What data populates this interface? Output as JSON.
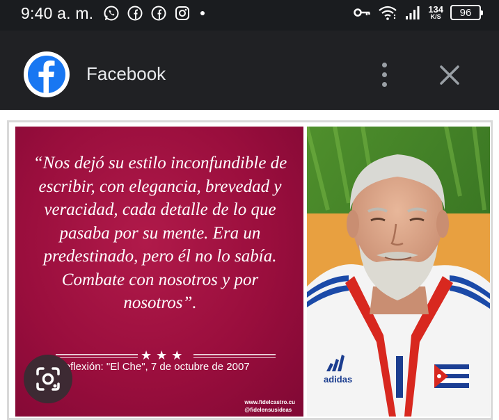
{
  "status_bar": {
    "time": "9:40 a. m.",
    "left_icons": [
      "whatsapp-icon",
      "facebook-icon",
      "facebook-icon",
      "instagram-icon",
      "dot-icon"
    ],
    "right_icons": [
      "vpn-key-icon",
      "wifi-icon",
      "signal-icon"
    ],
    "net_speed_value": "134",
    "net_speed_unit": "K/S",
    "battery": "96"
  },
  "app_bar": {
    "title": "Facebook",
    "logo_icon": "facebook-logo-icon",
    "menu_icon": "more-vert-icon",
    "close_icon": "close-icon",
    "background": "#202124"
  },
  "post": {
    "quote": "“Nos dejó su estilo inconfundible de escribir, con elegancia, brevedad y veracidad, cada detalle de lo que pasaba por su mente.  Era un predestinado, pero él no lo sabía. Combate con nosotros y por nosotros”.",
    "stars": "★★★",
    "reflexion": "Reflexión: \"El Che\", 7 de octubre de 2007",
    "site": "www.fidelcastro.cu",
    "handle": "@fidelensusideas",
    "jacket_brand": "adidas",
    "accent": "#9a0e3d"
  },
  "lens_button": {
    "icon": "google-lens-icon"
  }
}
